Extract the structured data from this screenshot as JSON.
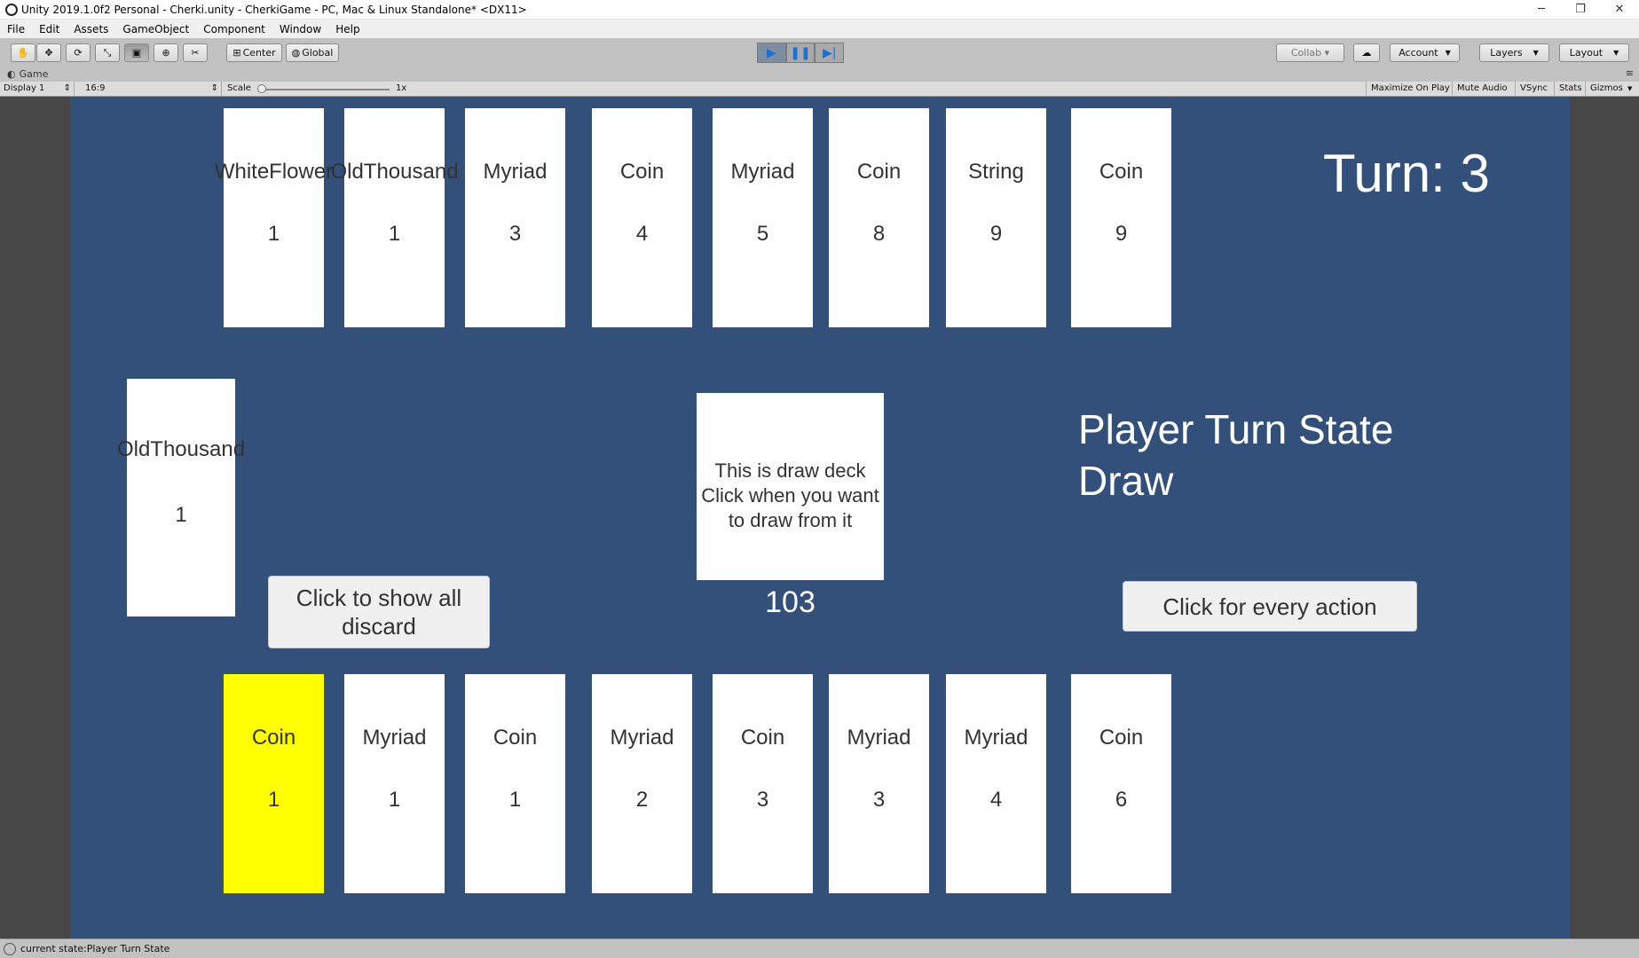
{
  "window": {
    "title": "Unity 2019.1.0f2 Personal - Cherki.unity - CherkiGame - PC, Mac & Linux Standalone* <DX11>",
    "minimize": "─",
    "maximize": "❐",
    "close": "✕"
  },
  "menu": [
    "File",
    "Edit",
    "Assets",
    "GameObject",
    "Component",
    "Window",
    "Help"
  ],
  "toolbar": {
    "tools": [
      "hand-tool",
      "move-tool",
      "rotate-tool",
      "scale-tool",
      "rect-tool",
      "transform-tool",
      "custom-tool"
    ],
    "pivot_label": "Center",
    "space_label": "Global",
    "collab_label": "Collab ▾",
    "account_label": "Account",
    "layers_label": "Layers",
    "layout_label": "Layout"
  },
  "game_tab": {
    "label": "Game"
  },
  "game_bar": {
    "display": "Display 1",
    "aspect": "16:9",
    "scale_label": "Scale",
    "scale_value": "1x",
    "maximize_on_play": "Maximize On Play",
    "mute_audio": "Mute Audio",
    "vsync": "VSync",
    "stats": "Stats",
    "gizmos": "Gizmos"
  },
  "game": {
    "turn_label": "Turn: 3",
    "state_line1": "Player Turn State",
    "state_line2": "Draw",
    "opponent_cards": [
      {
        "name": "WhiteFlower",
        "value": "1"
      },
      {
        "name": "OldThousand",
        "value": "1"
      },
      {
        "name": "Myriad",
        "value": "3"
      },
      {
        "name": "Coin",
        "value": "4"
      },
      {
        "name": "Myriad",
        "value": "5"
      },
      {
        "name": "Coin",
        "value": "8"
      },
      {
        "name": "String",
        "value": "9"
      },
      {
        "name": "Coin",
        "value": "9"
      }
    ],
    "player_cards": [
      {
        "name": "Coin",
        "value": "1",
        "selected": true
      },
      {
        "name": "Myriad",
        "value": "1"
      },
      {
        "name": "Coin",
        "value": "1"
      },
      {
        "name": "Myriad",
        "value": "2"
      },
      {
        "name": "Coin",
        "value": "3"
      },
      {
        "name": "Myriad",
        "value": "3"
      },
      {
        "name": "Myriad",
        "value": "4"
      },
      {
        "name": "Coin",
        "value": "6"
      }
    ],
    "discard_top": {
      "name": "OldThousand",
      "value": "1"
    },
    "discard_button": "Click to show all discard",
    "draw_deck_text": "This is draw deck Click when you want to draw from it",
    "draw_deck_count": "103",
    "action_button": "Click for every action",
    "colors": {
      "background": "#32507a",
      "card": "#ffffff",
      "selected_card": "#ffff00",
      "text": "#323232"
    }
  },
  "status": {
    "text": "current state:Player Turn State"
  }
}
